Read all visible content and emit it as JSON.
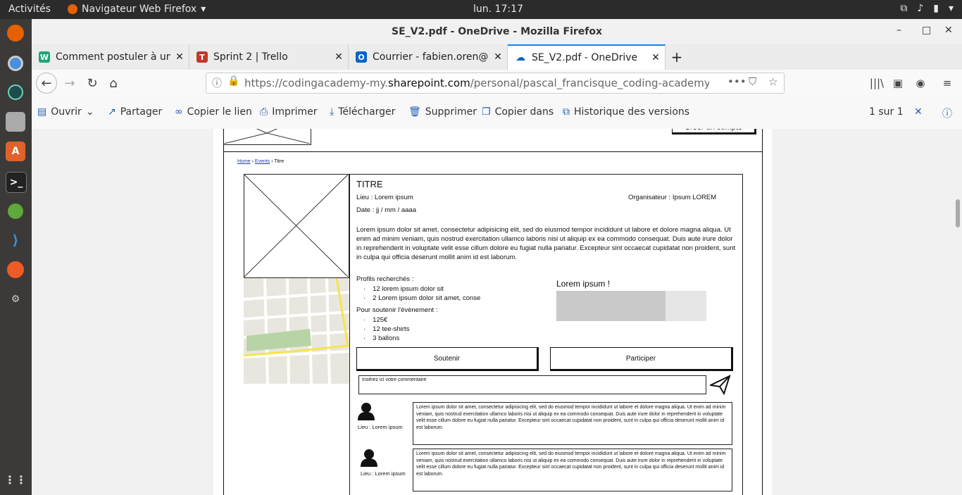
{
  "system": {
    "activities": "Activités",
    "app_name": "Navigateur Web Firefox",
    "clock": "lun. 17:17"
  },
  "window": {
    "title": "SE_V2.pdf - OneDrive - Mozilla Firefox"
  },
  "tabs": [
    {
      "label": "Comment postuler à un j",
      "icon": "W",
      "color": "#1aa773"
    },
    {
      "label": "Sprint 2 | Trello",
      "icon": "T",
      "color": "#c0392b"
    },
    {
      "label": "Courrier - fabien.oren@c",
      "icon": "O",
      "color": "#0a64c2"
    },
    {
      "label": "SE_V2.pdf - OneDrive",
      "icon": "cloud",
      "color": "#0a64c2"
    }
  ],
  "nav": {
    "url_prefix": "https://codingacademy-my.",
    "url_domain": "sharepoint.com",
    "url_suffix": "/personal/pascal_francisque_coding-academy_fr/_layo"
  },
  "onedrive": {
    "open": "Ouvrir",
    "share": "Partager",
    "copy_link": "Copier le lien",
    "print": "Imprimer",
    "download": "Télécharger",
    "delete": "Supprimer",
    "copy_to": "Copier dans",
    "history": "Historique des versions",
    "page_count": "1 sur 1"
  },
  "wireframe": {
    "create_account": "Créer un compte",
    "breadcrumb": {
      "home": "Home",
      "events": "Events",
      "current": "Titre"
    },
    "title": "TITRE",
    "lieu": "Lieu : Lorem ipsum",
    "organisateur": "Organisateur : Ipsum LOREM",
    "date": "Date : jj / mm / aaaa",
    "description": "Lorem ipsum dolor sit amet, consectetur adipisicing elit, sed do eiusmod tempor incididunt ut labore et dolore magna aliqua. Ut enim ad minim veniam, quis nostrud exercitation ullamco laboris nisi ut aliquip ex ea commodo consequat. Duis aute irure dolor in reprehenderit in voluptate velit esse cillum dolore eu fugiat nulla pariatur. Excepteur sint occaecat cupidatat non proident, sunt in culpa qui officia deserunt mollit anim id est laborum.",
    "profiles_heading": "Profils recherchés :",
    "profiles": [
      "12 lorem ipsum dolor sit",
      "2 Lorem ipsum dolor sit amet, conse"
    ],
    "support_heading": "Pour soutenir l'évènement :",
    "support": [
      "125€",
      "12 tee-shirts",
      "3  ballons"
    ],
    "progress_label": "Lorem ipsum !",
    "progress": 0.73,
    "soutenir": "Soutenir",
    "participer": "Participer",
    "comment_placeholder": "Insérez ici votre commentaire",
    "comments": [
      {
        "author": "Lieu : Lorem ipsum",
        "text": "Lorem ipsum dolor sit amet, consectetur adipisicing elit, sed do eiusmod tempor incididunt ut labore et dolore magna aliqua. Ut enim ad minim veniam, quis nostrud exercitation ullamco laboris nisi ut aliquip ex ea commodo consequat. Duis aute irure dolor in reprehenderit in voluptate velit esse cillum dolore eu fugiat nulla pariatur. Excepteur sint occaecat cupidatat non proident, sunt in culpa qui officia deserunt mollit anim id est laborum."
      },
      {
        "author": "Lieu : Lorem ipsum",
        "text": "Lorem ipsum dolor sit amet, consectetur adipisicing elit, sed do eiusmod tempor incididunt ut labore et dolore magna aliqua. Ut enim ad minim veniam, quis nostrud exercitation ullamco laboris nisi ut aliquip ex ea commodo consequat. Duis aute irure dolor in reprehenderit in voluptate velit esse cillum dolore eu fugiat nulla pariatur. Excepteur sint occaecat cupidatat non proident, sunt in culpa qui officia deserunt mollit anim id est laborum."
      }
    ]
  },
  "colors": {
    "accent": "#0a84ff",
    "onedrive_blue": "#1f5fae"
  }
}
